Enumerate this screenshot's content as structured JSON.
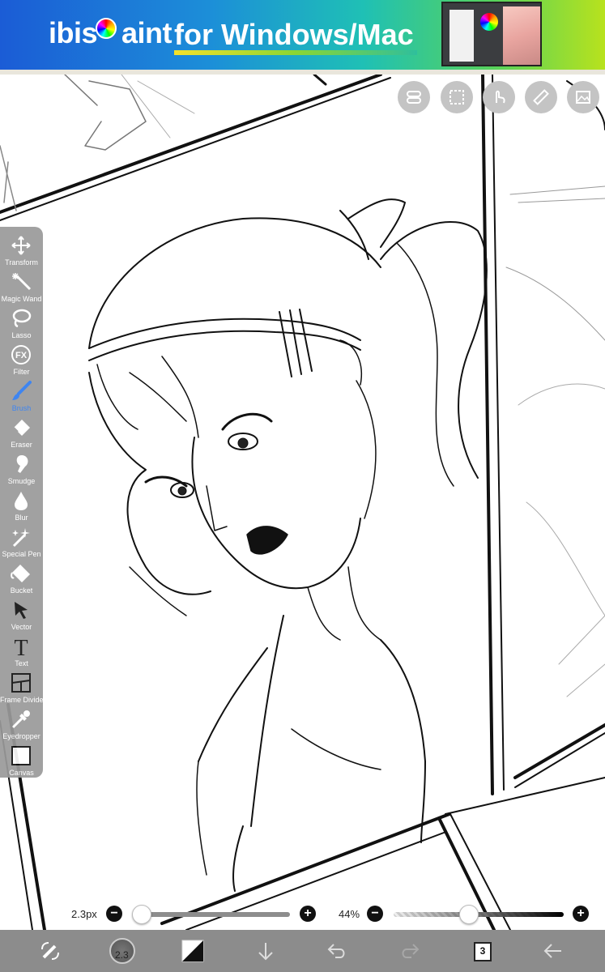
{
  "ad": {
    "logo_prefix": "ibis",
    "logo_suffix": "aint",
    "tagline": "for Windows/Mac"
  },
  "toolbar": {
    "tools": [
      {
        "label": "Transform",
        "icon": "move-arrows-icon"
      },
      {
        "label": "Magic Wand",
        "icon": "magic-wand-icon"
      },
      {
        "label": "Lasso",
        "icon": "lasso-icon"
      },
      {
        "label": "Filter",
        "icon": "fx-icon"
      },
      {
        "label": "Brush",
        "icon": "brush-icon",
        "active": true
      },
      {
        "label": "Eraser",
        "icon": "eraser-icon"
      },
      {
        "label": "Smudge",
        "icon": "smudge-icon"
      },
      {
        "label": "Blur",
        "icon": "droplet-icon"
      },
      {
        "label": "Special Pen",
        "icon": "sparkle-pen-icon"
      },
      {
        "label": "Bucket",
        "icon": "bucket-icon"
      },
      {
        "label": "Vector",
        "icon": "cursor-arrow-icon"
      },
      {
        "label": "Text",
        "icon": "text-t-icon"
      },
      {
        "label": "Frame Divider",
        "icon": "frame-divider-icon"
      },
      {
        "label": "Eyedropper",
        "icon": "eyedropper-icon"
      },
      {
        "label": "Canvas",
        "icon": "canvas-square-icon"
      }
    ],
    "active_color": "#2e7bf0"
  },
  "sliders": {
    "brush_size": {
      "label": "2.3px",
      "value_fraction": 0.02
    },
    "opacity": {
      "label": "44%",
      "value_fraction": 0.44
    }
  },
  "bottom_bar": {
    "brush_size_badge": "2.3",
    "layer_count": "3"
  }
}
